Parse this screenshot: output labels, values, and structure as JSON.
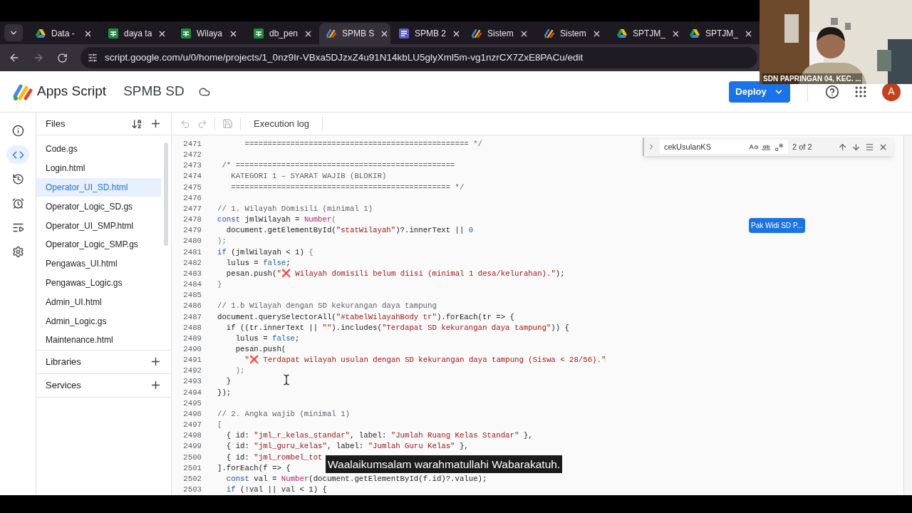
{
  "browser": {
    "tabs": [
      {
        "label": "Data -",
        "kind": "drive",
        "selected": false
      },
      {
        "label": "daya ta",
        "kind": "sheets",
        "selected": false
      },
      {
        "label": "Wilaya",
        "kind": "sheets",
        "selected": false
      },
      {
        "label": "db_pen",
        "kind": "sheets",
        "selected": false
      },
      {
        "label": "SPMB S",
        "kind": "script",
        "selected": true
      },
      {
        "label": "SPMB 2",
        "kind": "forms",
        "selected": false
      },
      {
        "label": "Sistem",
        "kind": "script",
        "selected": false
      },
      {
        "label": "Sistem",
        "kind": "script",
        "selected": false
      },
      {
        "label": "SPTJM_",
        "kind": "drive",
        "selected": false
      },
      {
        "label": "SPTJM_",
        "kind": "drive",
        "selected": false
      }
    ],
    "url": "script.google.com/u/0/home/projects/1_0nz9Ir-VBxa5DJzxZ4u91N14kbLU5glyXml5m-vg1nzrCX7ZxE8PACu/edit"
  },
  "header": {
    "app_name": "Apps Script",
    "project": "SPMB SD",
    "deploy": "Deploy",
    "avatar": "A"
  },
  "rail": [
    {
      "kind": "info",
      "selected": false
    },
    {
      "kind": "code",
      "selected": true
    },
    {
      "kind": "history",
      "selected": false
    },
    {
      "kind": "triggers",
      "selected": false
    },
    {
      "kind": "executions",
      "selected": false
    },
    {
      "kind": "settings",
      "selected": false
    }
  ],
  "files": {
    "title": "Files",
    "items": [
      {
        "name": "Code.gs",
        "selected": false
      },
      {
        "name": "Login.html",
        "selected": false
      },
      {
        "name": "Operator_UI_SD.html",
        "selected": true
      },
      {
        "name": "Operator_Logic_SD.gs",
        "selected": false
      },
      {
        "name": "Operator_UI_SMP.html",
        "selected": false
      },
      {
        "name": "Operator_Logic_SMP.gs",
        "selected": false
      },
      {
        "name": "Pengawas_UI.html",
        "selected": false
      },
      {
        "name": "Pengawas_Logic.gs",
        "selected": false
      },
      {
        "name": "Admin_UI.html",
        "selected": false
      },
      {
        "name": "Admin_Logic.gs",
        "selected": false
      },
      {
        "name": "Maintenance.html",
        "selected": false
      }
    ]
  },
  "sections": [
    {
      "label": "Libraries"
    },
    {
      "label": "Services"
    }
  ],
  "toolbar": {
    "execution_log": "Execution log"
  },
  "find": {
    "value": "cekUsulanKS",
    "count": "2 of 2"
  },
  "code": [
    {
      "number": "2471",
      "tokens": [
        {
          "kind": "comment",
          "text": "      ================================================= */"
        }
      ]
    },
    {
      "number": "2472"
    },
    {
      "number": "2473",
      "tokens": [
        {
          "kind": "comment",
          "text": " /* ================================================"
        }
      ]
    },
    {
      "number": "2474",
      "tokens": [
        {
          "kind": "comment",
          "text": "   KATEGORI 1 – SYARAT WAJIB (BLOKIR)"
        }
      ]
    },
    {
      "number": "2475",
      "tokens": [
        {
          "kind": "comment",
          "text": "   ================================================ */"
        }
      ]
    },
    {
      "number": "2476"
    },
    {
      "number": "2477",
      "tokens": [
        {
          "kind": "comment",
          "text": "// 1. Wilayah Domisili (minimal 1)"
        }
      ]
    },
    {
      "number": "2478",
      "tokens": [
        {
          "kind": "keyword",
          "text": "const"
        },
        {
          "kind": "plain",
          "text": " jmlWilayah = "
        },
        {
          "kind": "function",
          "text": "Number"
        },
        {
          "kind": "punct",
          "text": "("
        }
      ]
    },
    {
      "number": "2479",
      "tokens": [
        {
          "kind": "plain",
          "text": "  document.getElementById("
        },
        {
          "kind": "string",
          "text": "\"statWilayah\""
        },
        {
          "kind": "plain",
          "text": ")?.innerText || "
        },
        {
          "kind": "literal",
          "text": "0"
        }
      ]
    },
    {
      "number": "2480",
      "tokens": [
        {
          "kind": "punct",
          "text": ");"
        }
      ]
    },
    {
      "number": "2481",
      "tokens": [
        {
          "kind": "keyword",
          "text": "if"
        },
        {
          "kind": "plain",
          "text": " (jmlWilayah < 1) "
        },
        {
          "kind": "punct",
          "text": "{"
        }
      ]
    },
    {
      "number": "2482",
      "tokens": [
        {
          "kind": "plain",
          "text": "  lulus = "
        },
        {
          "kind": "literal",
          "text": "false"
        },
        {
          "kind": "plain",
          "text": ";"
        }
      ]
    },
    {
      "number": "2483",
      "tokens": [
        {
          "kind": "plain",
          "text": "  pesan.push("
        },
        {
          "kind": "string",
          "text": "\"❌ Wilayah domisili belum diisi (minimal 1 desa/kelurahan).\""
        },
        {
          "kind": "plain",
          "text": ");"
        }
      ]
    },
    {
      "number": "2484",
      "tokens": [
        {
          "kind": "punct",
          "text": "}"
        }
      ]
    },
    {
      "number": "2485"
    },
    {
      "number": "2486",
      "tokens": [
        {
          "kind": "comment",
          "text": "// 1.b Wilayah dengan SD kekurangan daya tampung"
        }
      ]
    },
    {
      "number": "2487",
      "tokens": [
        {
          "kind": "plain",
          "text": "document.querySelectorAll("
        },
        {
          "kind": "string",
          "text": "\"#tabelWilayahBody tr\""
        },
        {
          "kind": "plain",
          "text": ").forEach(tr => {"
        }
      ]
    },
    {
      "number": "2488",
      "tokens": [
        {
          "kind": "plain",
          "text": "  if ((tr.innerText || "
        },
        {
          "kind": "string",
          "text": "\"\""
        },
        {
          "kind": "plain",
          "text": ").includes("
        },
        {
          "kind": "string",
          "text": "\"Terdapat SD kekurangan daya tampung\""
        },
        {
          "kind": "plain",
          "text": ")) {"
        }
      ]
    },
    {
      "number": "2489",
      "tokens": [
        {
          "kind": "plain",
          "text": "    lulus = "
        },
        {
          "kind": "literal",
          "text": "false"
        },
        {
          "kind": "plain",
          "text": ";"
        }
      ]
    },
    {
      "number": "2490",
      "tokens": [
        {
          "kind": "plain",
          "text": "    pesan.push("
        }
      ]
    },
    {
      "number": "2491",
      "tokens": [
        {
          "kind": "string",
          "text": "      \"❌ Terdapat wilayah usulan dengan SD kekurangan daya tampung (Siswa < 28/56).\""
        }
      ]
    },
    {
      "number": "2492",
      "tokens": [
        {
          "kind": "punct",
          "text": "    );"
        }
      ]
    },
    {
      "number": "2493",
      "tokens": [
        {
          "kind": "plain",
          "text": "  }"
        }
      ]
    },
    {
      "number": "2494",
      "tokens": [
        {
          "kind": "plain",
          "text": "});"
        }
      ]
    },
    {
      "number": "2495"
    },
    {
      "number": "2496",
      "tokens": [
        {
          "kind": "comment",
          "text": "// 2. Angka wajib (minimal 1)"
        }
      ]
    },
    {
      "number": "2497",
      "tokens": [
        {
          "kind": "punct",
          "text": "["
        }
      ]
    },
    {
      "number": "2498",
      "tokens": [
        {
          "kind": "plain",
          "text": "  { id: "
        },
        {
          "kind": "string",
          "text": "\"jml_r_kelas_standar\""
        },
        {
          "kind": "plain",
          "text": ", label: "
        },
        {
          "kind": "string",
          "text": "\"Jumlah Ruang Kelas Standar\""
        },
        {
          "kind": "plain",
          "text": " },"
        }
      ]
    },
    {
      "number": "2499",
      "tokens": [
        {
          "kind": "plain",
          "text": "  { id: "
        },
        {
          "kind": "string",
          "text": "\"jml_guru_kelas\""
        },
        {
          "kind": "plain",
          "text": ", label: "
        },
        {
          "kind": "string",
          "text": "\"Jumlah Guru Kelas\""
        },
        {
          "kind": "plain",
          "text": " },"
        }
      ]
    },
    {
      "number": "2500",
      "tokens": [
        {
          "kind": "plain",
          "text": "  { id: "
        },
        {
          "kind": "string",
          "text": "\"jml_rombel_tot"
        }
      ]
    },
    {
      "number": "2501",
      "tokens": [
        {
          "kind": "plain",
          "text": "].forEach(f => {"
        }
      ]
    },
    {
      "number": "2502",
      "tokens": [
        {
          "kind": "keyword",
          "text": "  const"
        },
        {
          "kind": "plain",
          "text": " val = "
        },
        {
          "kind": "function",
          "text": "Number"
        },
        {
          "kind": "plain",
          "text": "(document.getElementById(f.id)?.value);"
        }
      ]
    },
    {
      "number": "2503",
      "tokens": [
        {
          "kind": "keyword",
          "text": "  if"
        },
        {
          "kind": "plain",
          "text": " (!val || val < 1) {"
        }
      ]
    }
  ],
  "overlays": {
    "participant": "SDN PAPRINGAN 04, KEC. ...",
    "pointer_label": "Pak Widi SD P...",
    "caption": "Waalaikumsalam warahmatullahi Wabarakatuh."
  }
}
